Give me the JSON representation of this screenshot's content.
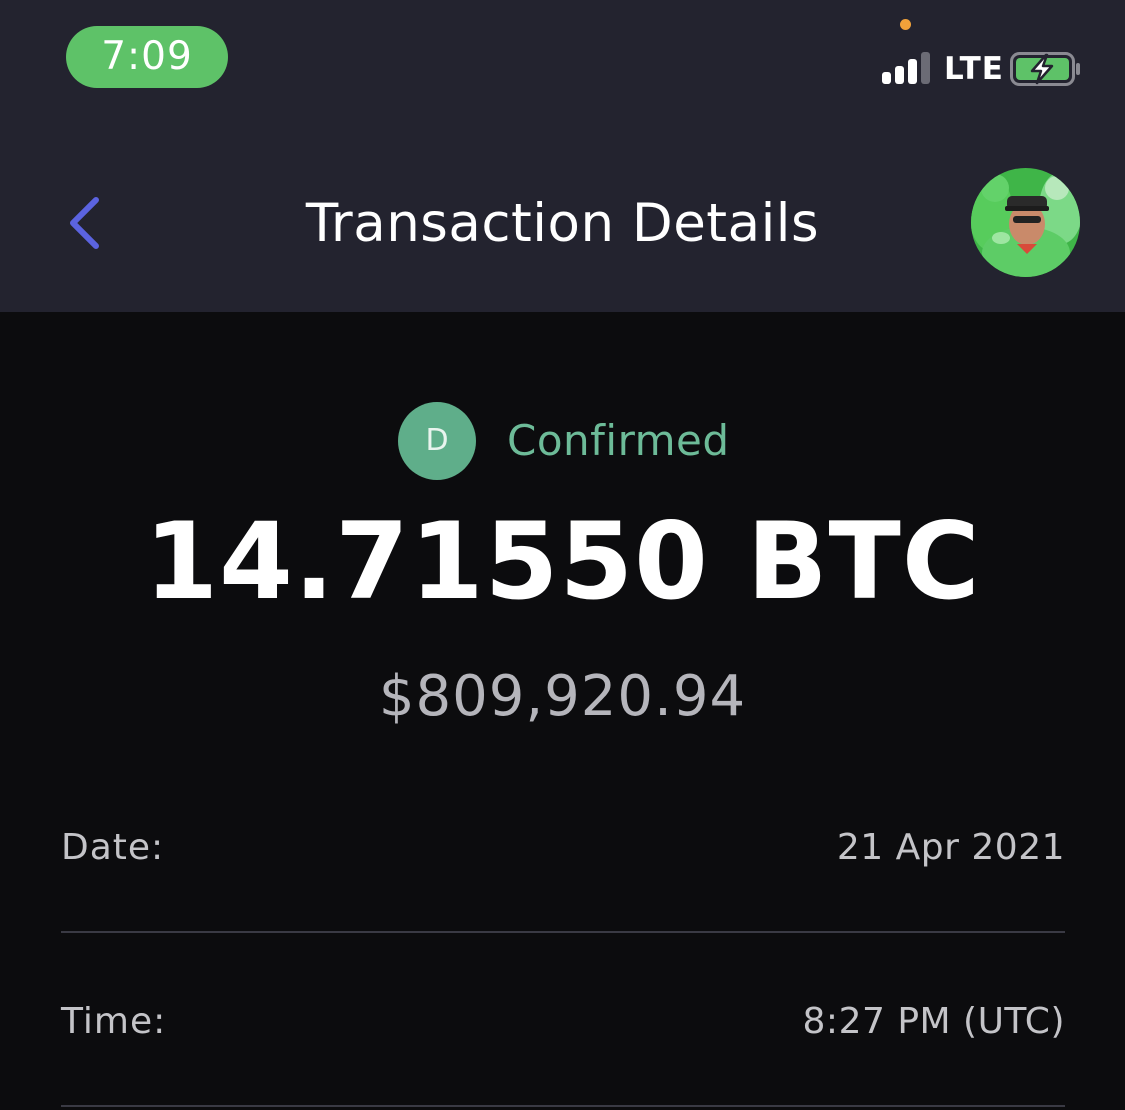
{
  "status_bar": {
    "time": "7:09",
    "network": "LTE",
    "time_pill_color": "#5ec268",
    "signal_bars_active": 3,
    "signal_bars_total": 4,
    "battery_charging": true
  },
  "header": {
    "title": "Transaction Details",
    "back_icon": "chevron-left-icon",
    "accent": "#5b63e0"
  },
  "transaction": {
    "status_initial": "D",
    "status": "Confirmed",
    "status_color": "#6dbb98",
    "amount": "14.71550 BTC",
    "fiat_value": "$809,920.94"
  },
  "details": [
    {
      "label": "Date:",
      "value": "21 Apr 2021"
    },
    {
      "label": "Time:",
      "value": "8:27 PM (UTC)"
    }
  ]
}
